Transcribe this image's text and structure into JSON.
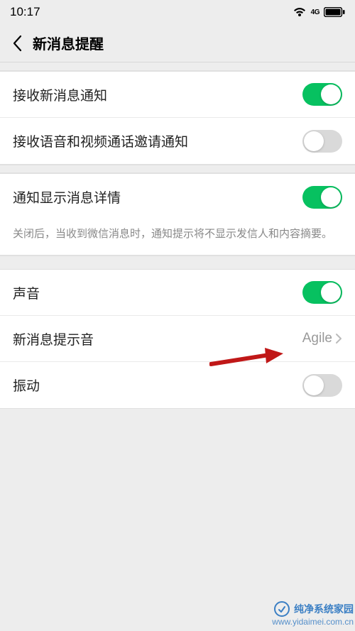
{
  "status": {
    "time": "10:17",
    "network": "4G"
  },
  "header": {
    "title": "新消息提醒"
  },
  "rows": {
    "receive_new": "接收新消息通知",
    "receive_call": "接收语音和视频通话邀请通知",
    "show_detail": "通知显示消息详情",
    "show_detail_desc": "关闭后，当收到微信消息时，通知提示将不显示发信人和内容摘要。",
    "sound": "声音",
    "tone": "新消息提示音",
    "tone_value": "Agile",
    "vibrate": "振动"
  },
  "watermark": {
    "brand": "纯净系统家园",
    "url": "www.yidaimei.com.cn"
  }
}
